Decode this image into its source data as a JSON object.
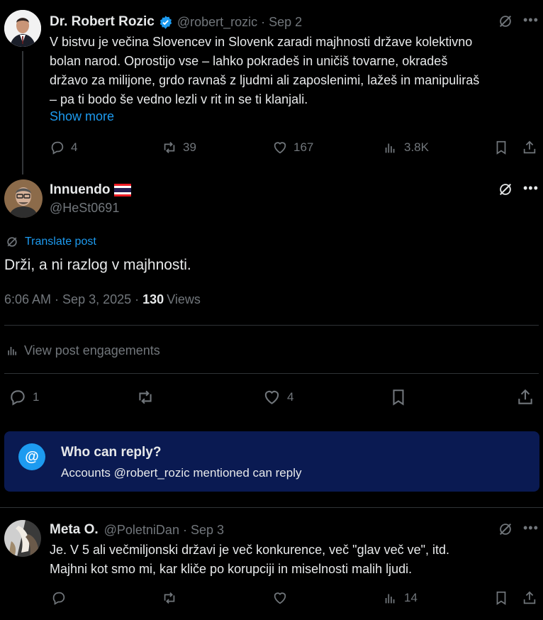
{
  "parent_post": {
    "author_name": "Dr. Robert Rozic",
    "handle": "@robert_rozic",
    "date": "Sep 2",
    "text_lines": [
      "V bistvu je večina Slovencev in Slovenk zaradi majhnosti države kolektivno",
      "bolan narod. Oprostijo vse – lahko pokradeš in uničiš tovarne, okradeš",
      "državo za milijone, grdo ravnaš z ljudmi ali zaposlenimi, lažeš in manipuliraš",
      "– pa ti bodo še vedno lezli v rit in se ti  klanjali."
    ],
    "show_more": "Show more",
    "replies": "4",
    "reposts": "39",
    "likes": "167",
    "views": "3.8K"
  },
  "main_post": {
    "author_name": "Innuendo",
    "handle": "@HeSt0691",
    "translate": "Translate post",
    "text": "Drži, a ni razlog v majhnosti.",
    "time": "6:06 AM",
    "date": "Sep 3, 2025",
    "views_count": "130",
    "views_label": "Views",
    "engagements": "View post engagements",
    "replies": "1",
    "likes": "4"
  },
  "reply_box": {
    "title": "Who can reply?",
    "subtitle": "Accounts @robert_rozic mentioned can reply"
  },
  "reply_post": {
    "author_name": "Meta O.",
    "handle": "@PoletniDan",
    "date": "Sep 3",
    "text_lines": [
      "Je. V 5 ali večmiljonski državi je več konkurence, več \"glav več ve\", itd.",
      "Majhni kot smo mi, kar kliče po korupciji in miselnosti malih ljudi."
    ],
    "views": "14"
  },
  "colors": {
    "background": "#000000",
    "text": "#e7e9ea",
    "muted": "#71767b",
    "accent": "#1d9bf0",
    "verified": "#1d9bf0",
    "reply_box_bg": "#0a1a52"
  }
}
